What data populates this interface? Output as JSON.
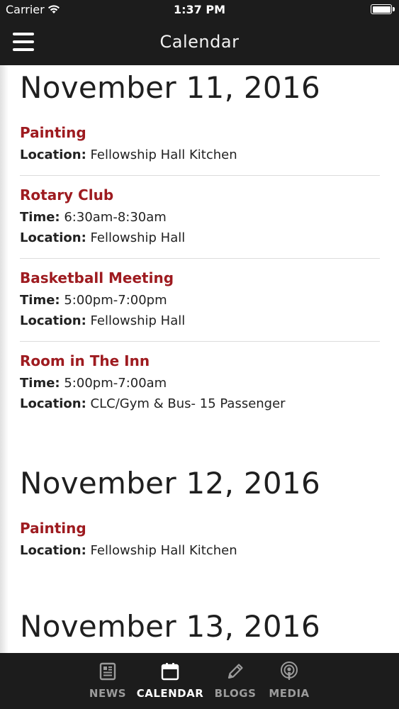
{
  "status_bar": {
    "carrier": "Carrier",
    "time": "1:37 PM",
    "wifi_icon": "wifi-icon",
    "battery_icon": "battery-icon"
  },
  "nav": {
    "title": "Calendar",
    "menu_icon": "hamburger-menu-icon"
  },
  "labels": {
    "time": "Time:",
    "location": "Location:"
  },
  "days": [
    {
      "date": "November 11, 2016",
      "events": [
        {
          "title": "Painting",
          "location": "Fellowship Hall Kitchen"
        },
        {
          "title": "Rotary Club",
          "time": "6:30am-8:30am",
          "location": "Fellowship Hall"
        },
        {
          "title": "Basketball Meeting",
          "time": "5:00pm-7:00pm",
          "location": "Fellowship Hall"
        },
        {
          "title": "Room in The Inn",
          "time": "5:00pm-7:00am",
          "location": "CLC/Gym & Bus- 15 Passenger"
        }
      ]
    },
    {
      "date": "November 12, 2016",
      "events": [
        {
          "title": "Painting",
          "location": "Fellowship Hall Kitchen"
        }
      ]
    },
    {
      "date": "November 13, 2016",
      "events": []
    }
  ],
  "tabs": [
    {
      "label": "NEWS",
      "icon": "newspaper-icon",
      "active": false
    },
    {
      "label": "CALENDAR",
      "icon": "calendar-icon",
      "active": true
    },
    {
      "label": "BLOGS",
      "icon": "pencil-icon",
      "active": false
    },
    {
      "label": "MEDIA",
      "icon": "podcast-icon",
      "active": false
    }
  ],
  "colors": {
    "bar_background": "#1c1c1c",
    "event_title": "#9e1b20",
    "tab_inactive": "#9b9b9b",
    "tab_active": "#ffffff"
  }
}
